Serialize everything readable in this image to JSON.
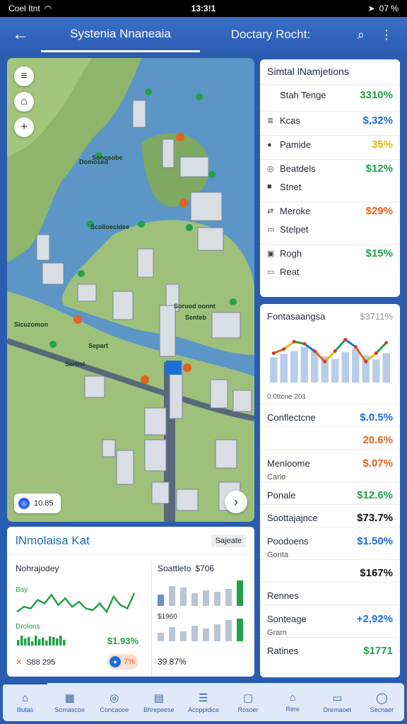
{
  "status_bar": {
    "carrier": "Coel Itnt",
    "time": "13:3!1",
    "battery": "07 %"
  },
  "app_bar": {
    "tab_active": "Systenia Nnaneaia",
    "tab_other": "Doctary Rocht:"
  },
  "map": {
    "labels": [
      "Sonosobe",
      "Scolioecidee",
      "Soruod oonnt",
      "Sicuzomon",
      "Senteb",
      "Separt",
      "Sartiol",
      "Domosed"
    ],
    "scale_value": "10.85",
    "icons": [
      "menu-icon",
      "compass-icon",
      "plus-icon",
      "arrow-right-icon"
    ]
  },
  "sim_panel": {
    "title": "Simtal lNamjetions",
    "rows": [
      {
        "icon": "",
        "label": "Stah Tenge",
        "value": "3310%",
        "color": "#22a04a"
      },
      {
        "icon": "≣",
        "label": "Kcas",
        "value": "$,32%",
        "color": "#1d6fd8"
      },
      {
        "icon": "●",
        "label": "Pamide",
        "value": "35%",
        "color": "#e6b80d"
      },
      {
        "icon": "◎",
        "label": "Beatdels",
        "value": "$12%",
        "color": "#22a04a"
      },
      {
        "icon": "■",
        "label": "Stnet",
        "value": "",
        "color": "#111"
      },
      {
        "icon": "⇄",
        "label": "Meroke",
        "value": "$29%",
        "color": "#e2631d"
      },
      {
        "icon": "▭",
        "label": "Stelpet",
        "value": "",
        "color": "#111"
      },
      {
        "icon": "▣",
        "label": "Rogh",
        "value": "$15%",
        "color": "#22a04a"
      },
      {
        "icon": "▭",
        "label": "Reat",
        "value": "",
        "color": "#111"
      }
    ]
  },
  "summary_panel": {
    "title": "Fontasaangsa",
    "title_value": "$3711%",
    "caption": "0.0ttcne 201",
    "rows": [
      {
        "label": "Conflectcne",
        "sub": "",
        "value": "$.0.5%",
        "color": "#1d6fd8"
      },
      {
        "label": "",
        "sub": "",
        "value": "20.6%",
        "color": "#e2631d"
      },
      {
        "label": "Menloome",
        "sub": "Carlo",
        "value": "$.07%",
        "color": "#e2631d"
      },
      {
        "label": "Ponale",
        "sub": "",
        "value": "$12.6%",
        "color": "#22a04a"
      },
      {
        "label": "Soottajajnce",
        "sub": "",
        "value": "$73.7%",
        "color": "#111"
      },
      {
        "label": "Poodoens",
        "sub": "Gonta",
        "value": "$1.50%",
        "color": "#1d6fd8"
      },
      {
        "label": "",
        "sub": "",
        "value": "$167%",
        "color": "#111"
      },
      {
        "label": "Rennes",
        "sub": "",
        "value": "",
        "color": "#111"
      },
      {
        "label": "Sonteage",
        "sub": "Gram",
        "value": "+2,92%",
        "color": "#1d6fd8"
      },
      {
        "label": "Ratines",
        "sub": "",
        "value": "$1771",
        "color": "#22a04a"
      }
    ],
    "chart_data": {
      "type": "bar",
      "categories": [
        "1",
        "2",
        "3",
        "4",
        "5",
        "6",
        "7",
        "8",
        "9",
        "10",
        "11",
        "12"
      ],
      "series": [
        {
          "values": [
            48,
            55,
            60,
            68,
            62,
            50,
            45,
            58,
            65,
            52,
            44,
            56
          ]
        },
        {
          "values": [
            56,
            64,
            78,
            74,
            60,
            40,
            60,
            82,
            68,
            40,
            56,
            76
          ]
        }
      ],
      "ylim": [
        0,
        100
      ]
    }
  },
  "market_panel": {
    "title": "lNmolaisa Kat",
    "tag": "Sajeate",
    "left": {
      "title": "Nohrajodey",
      "label1": "Bay",
      "label2": "Drolons",
      "value": "$1.93%",
      "footer_left": "S88 295",
      "footer_badge": "7%",
      "chart_data": {
        "type": "line",
        "values": [
          20,
          35,
          30,
          55,
          45,
          70,
          40,
          60,
          35,
          50,
          30,
          25,
          45,
          20,
          65,
          40,
          30,
          75
        ]
      },
      "bars": [
        8,
        14,
        10,
        12,
        6,
        14,
        9,
        11,
        7,
        13,
        12,
        10,
        14,
        8
      ]
    },
    "right": {
      "title": "Soattleto",
      "title_value": "$706",
      "label": "$1960",
      "footer": "39.87%",
      "chart_data": {
        "type": "bar",
        "values": [
          40,
          70,
          65,
          45,
          55,
          50,
          60,
          90,
          30,
          50,
          35,
          55,
          45,
          60,
          75,
          80,
          25,
          40,
          55
        ]
      }
    }
  },
  "bottom_nav": [
    {
      "label": "Iliutas",
      "icon": "home-icon",
      "glyph": "⌂"
    },
    {
      "label": "Somascoe",
      "icon": "grid-icon",
      "glyph": "▦"
    },
    {
      "label": "Concacoe",
      "icon": "gauge-icon",
      "glyph": "◎"
    },
    {
      "label": "Bhrepeese",
      "icon": "calendar-icon",
      "glyph": "▤"
    },
    {
      "label": "Acoppidice",
      "icon": "list-icon",
      "glyph": "☰"
    },
    {
      "label": "Rosoer",
      "icon": "document-icon",
      "glyph": "▢"
    },
    {
      "label": "Rere",
      "icon": "house-icon",
      "glyph": "⌂"
    },
    {
      "label": "Dremaoet",
      "icon": "chat-icon",
      "glyph": "▭"
    },
    {
      "label": "Secnaer",
      "icon": "shield-icon",
      "glyph": "◯"
    }
  ]
}
